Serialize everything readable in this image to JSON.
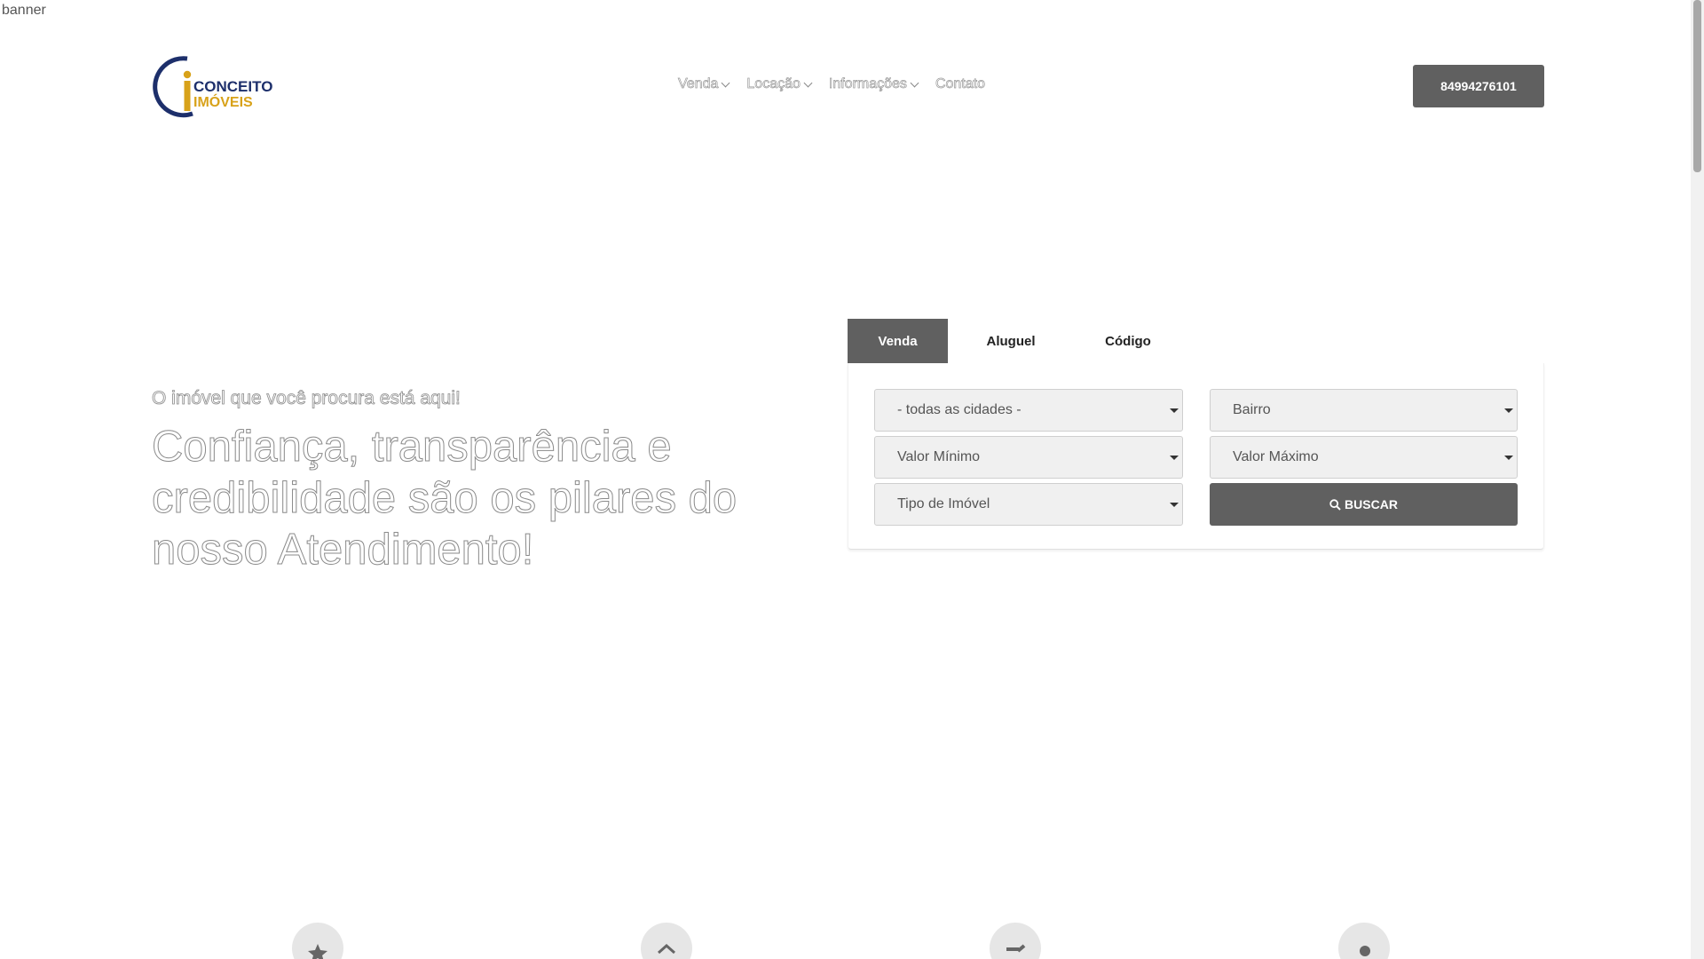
{
  "banner": {
    "alt": "banner"
  },
  "brand": {
    "line1": "CONCEITO",
    "line2": "IMÓVEIS",
    "colors": {
      "navy": "#1d2f6b",
      "gold": "#d8a21a"
    }
  },
  "nav": {
    "items": [
      {
        "label": "Venda",
        "has_dropdown": true
      },
      {
        "label": "Locação",
        "has_dropdown": true
      },
      {
        "label": "Informações",
        "has_dropdown": true
      },
      {
        "label": "Contato",
        "has_dropdown": false
      }
    ]
  },
  "header": {
    "phone": "84994276101"
  },
  "hero": {
    "subtitle": "O imóvel que você procura está aqui!",
    "title": "Confiança, transparência e credibilidade são os pilares do nosso Atendimento!"
  },
  "search": {
    "tabs": [
      {
        "label": "Venda",
        "active": true
      },
      {
        "label": "Aluguel",
        "active": false
      },
      {
        "label": "Código",
        "active": false
      }
    ],
    "fields": {
      "cidade": "- todas as cidades -",
      "bairro": "Bairro",
      "valor_min": "Valor Mínimo",
      "valor_max": "Valor Máximo",
      "tipo": "Tipo de Imóvel"
    },
    "button_label": "BUSCAR"
  },
  "features": {
    "icons": [
      "star-icon",
      "house-icon",
      "signature-icon",
      "location-pin-icon"
    ]
  },
  "colors": {
    "accent": "#606060",
    "field_bg": "#f0f0f0"
  }
}
